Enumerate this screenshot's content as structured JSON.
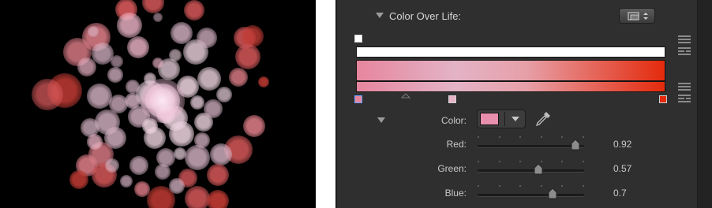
{
  "viewer": {
    "background": "#000000",
    "palette": [
      "#f0d6e2",
      "#d9b6c7",
      "#f2b9cc",
      "#e2808a",
      "#d7585a",
      "#c23b34"
    ]
  },
  "inspector": {
    "background": "#2f2f2f",
    "section_title": "Color Over Life:",
    "gradient": {
      "alpha_bar": "#ffffff",
      "start_color": "#e6869e",
      "end_color": "#e42a0c",
      "icons": [
        "gradient-presets-icon",
        "gradient-options-icon"
      ]
    },
    "color_row": {
      "label": "Color:",
      "swatch": "#e88fae",
      "icons": [
        "dropdown-arrow-icon",
        "eyedropper-icon"
      ]
    },
    "channels": [
      {
        "label": "Red:",
        "value": "0.92",
        "level": 0.92
      },
      {
        "label": "Green:",
        "value": "0.57",
        "level": 0.57
      },
      {
        "label": "Blue:",
        "value": "0.7",
        "level": 0.7
      }
    ]
  }
}
